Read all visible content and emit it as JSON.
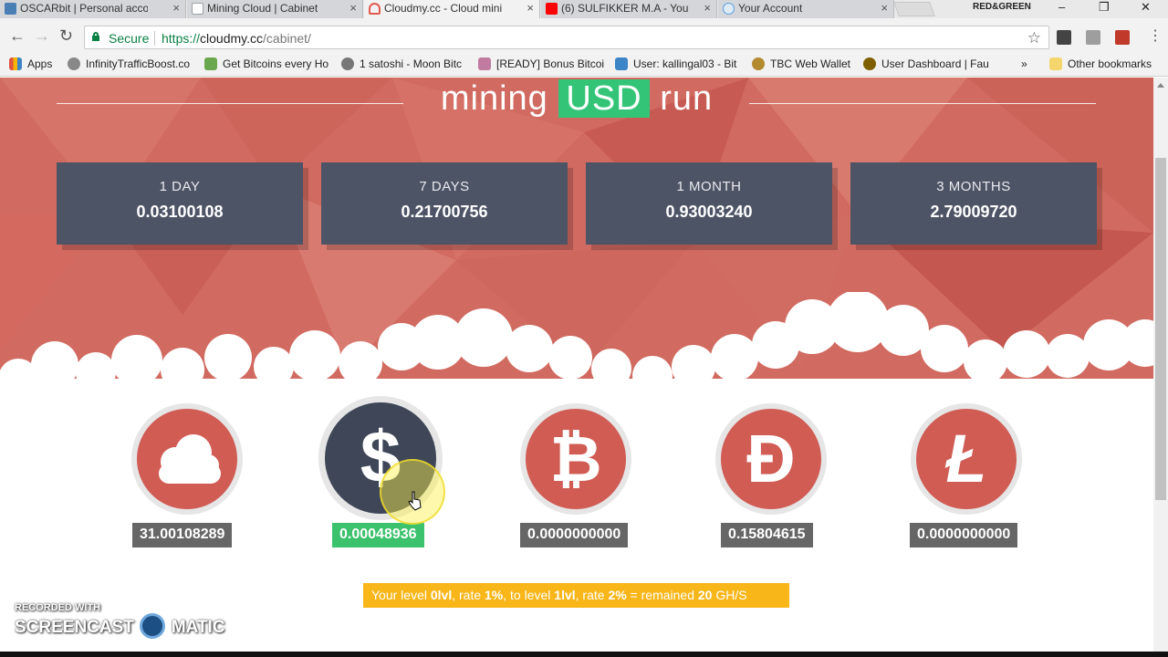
{
  "browser": {
    "tabs": [
      {
        "label": "OSCARbit | Personal acco",
        "color": "#4a7fb5",
        "active": false
      },
      {
        "label": "Mining Cloud | Cabinet",
        "color": "#9aa0a6",
        "active": false
      },
      {
        "label": "Cloudmy.cc - Cloud mini",
        "color": "#e05a4f",
        "active": true
      },
      {
        "label": "(6) SULFIKKER M.A - You",
        "color": "#ff0000",
        "active": false
      },
      {
        "label": "Your Account",
        "color": "#5aa0e0",
        "active": false
      }
    ],
    "profile": "RED&GREEN",
    "secure_label": "Secure",
    "url_scheme": "https://",
    "url_domain": "cloudmy.cc",
    "url_path": "/cabinet/",
    "bookmarks": [
      {
        "label": "Apps",
        "color": "#e0523f"
      },
      {
        "label": "InfinityTrafficBoost.co",
        "color": "#888888"
      },
      {
        "label": "Get Bitcoins every Ho",
        "color": "#6aa84f"
      },
      {
        "label": "1 satoshi - Moon Bitc",
        "color": "#777777"
      },
      {
        "label": "[READY] Bonus Bitcoi",
        "color": "#c27ba0"
      },
      {
        "label": "User: kallingal03 - Bit",
        "color": "#3d85c6"
      },
      {
        "label": "TBC Web Wallet",
        "color": "#b38b2e"
      },
      {
        "label": "User Dashboard | Fau",
        "color": "#7f6000"
      }
    ],
    "overflow": "»",
    "other_bookmarks": "Other bookmarks"
  },
  "page": {
    "title_prefix": "mining",
    "title_highlight": "USD",
    "title_suffix": "run",
    "periods": [
      {
        "label": "1 DAY",
        "value": "0.03100108"
      },
      {
        "label": "7 DAYS",
        "value": "0.21700756"
      },
      {
        "label": "1 MONTH",
        "value": "0.93003240"
      },
      {
        "label": "3 MONTHS",
        "value": "2.79009720"
      }
    ],
    "balances": [
      {
        "icon": "cloud-icon",
        "glyph": "",
        "value": "31.00108289"
      },
      {
        "icon": "dollar-icon",
        "glyph": "$",
        "value": "0.00048936"
      },
      {
        "icon": "bitcoin-icon",
        "glyph": "₿",
        "value": "0.0000000000"
      },
      {
        "icon": "dogecoin-icon",
        "glyph": "Đ",
        "value": "0.15804615"
      },
      {
        "icon": "litecoin-icon",
        "glyph": "Ł",
        "value": "0.0000000000"
      }
    ],
    "level": {
      "t1": "Your level ",
      "cur_level": "0lvl",
      "t2": ", rate ",
      "cur_rate": "1%",
      "t3": ", to level ",
      "next_level": "1lvl",
      "t4": ", rate ",
      "next_rate": "2%",
      "t5": " = remained ",
      "remained": "20",
      "unit": " GH/S"
    }
  },
  "watermark": {
    "line1": "RECORDED WITH",
    "left": "SCREENCAST",
    "right": "MATIC"
  },
  "colors": {
    "hero": "#d16a60",
    "accent_green": "#34c477",
    "card": "#4d5466",
    "coin_red": "#d05c54",
    "coin_dark": "#3e4658",
    "level_bar": "#f8b618"
  }
}
